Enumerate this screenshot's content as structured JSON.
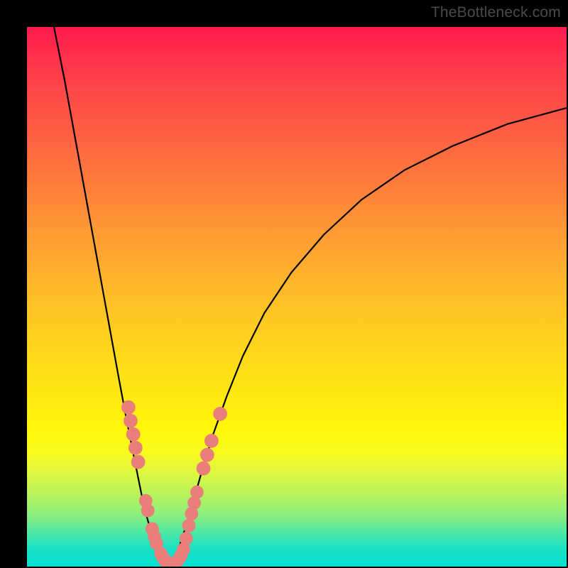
{
  "branding": {
    "watermark": "TheBottleneck.com"
  },
  "colors": {
    "gradient_top": "#ff1a4d",
    "gradient_mid": "#ffe812",
    "gradient_bottom": "#07dfd3",
    "curve": "#000000",
    "marker": "#e97e7b",
    "frame": "#000000"
  },
  "chart_data": {
    "type": "line",
    "title": "",
    "xlabel": "",
    "ylabel": "",
    "xlim": [
      0,
      100
    ],
    "ylim": [
      0,
      100
    ],
    "grid": false,
    "legend": false,
    "series": [
      {
        "name": "left-curve",
        "x": [
          5,
          7,
          9,
          11,
          13,
          15,
          17,
          18.5,
          19.5,
          20.5,
          21.3,
          22,
          22.7,
          23.4,
          24,
          24.6,
          25.2,
          25.8,
          26.3
        ],
        "y": [
          100,
          90,
          79,
          68,
          57,
          46,
          35,
          27,
          22,
          17,
          13,
          10,
          7.5,
          5.5,
          4,
          2.8,
          1.8,
          1,
          0.5
        ]
      },
      {
        "name": "right-curve",
        "x": [
          27,
          28,
          29.3,
          30.8,
          32.5,
          34.5,
          37,
          40,
          44,
          49,
          55,
          62,
          70,
          79,
          89,
          100
        ],
        "y": [
          0.5,
          3,
          7,
          12,
          18,
          24.5,
          31.5,
          39,
          47,
          54.5,
          61.5,
          68,
          73.5,
          78,
          82,
          85
        ]
      }
    ],
    "markers": [
      {
        "x": 18.8,
        "y": 29.5,
        "r": 1.1
      },
      {
        "x": 19.2,
        "y": 27.0,
        "r": 1.1
      },
      {
        "x": 19.7,
        "y": 24.5,
        "r": 1.1
      },
      {
        "x": 20.1,
        "y": 22.0,
        "r": 1.1
      },
      {
        "x": 20.6,
        "y": 19.4,
        "r": 1.1
      },
      {
        "x": 22.0,
        "y": 12.2,
        "r": 1.0
      },
      {
        "x": 22.4,
        "y": 10.4,
        "r": 1.0
      },
      {
        "x": 23.2,
        "y": 7.0,
        "r": 1.0
      },
      {
        "x": 23.6,
        "y": 5.6,
        "r": 1.0
      },
      {
        "x": 24.0,
        "y": 4.3,
        "r": 1.0
      },
      {
        "x": 24.8,
        "y": 2.4,
        "r": 1.0
      },
      {
        "x": 25.2,
        "y": 1.7,
        "r": 1.0
      },
      {
        "x": 25.6,
        "y": 1.1,
        "r": 1.0
      },
      {
        "x": 26.0,
        "y": 0.7,
        "r": 1.0
      },
      {
        "x": 26.4,
        "y": 0.5,
        "r": 1.0
      },
      {
        "x": 27.0,
        "y": 0.5,
        "r": 1.0
      },
      {
        "x": 27.5,
        "y": 0.7,
        "r": 1.0
      },
      {
        "x": 28.0,
        "y": 1.2,
        "r": 1.0
      },
      {
        "x": 28.5,
        "y": 2.0,
        "r": 1.0
      },
      {
        "x": 29.0,
        "y": 3.2,
        "r": 1.0
      },
      {
        "x": 29.5,
        "y": 5.2,
        "r": 1.0
      },
      {
        "x": 30.0,
        "y": 7.6,
        "r": 1.0
      },
      {
        "x": 30.5,
        "y": 9.8,
        "r": 1.0
      },
      {
        "x": 31.0,
        "y": 11.8,
        "r": 1.0
      },
      {
        "x": 31.5,
        "y": 13.8,
        "r": 1.0
      },
      {
        "x": 32.7,
        "y": 18.2,
        "r": 1.1
      },
      {
        "x": 33.4,
        "y": 20.7,
        "r": 1.1
      },
      {
        "x": 34.2,
        "y": 23.3,
        "r": 1.1
      },
      {
        "x": 35.8,
        "y": 28.3,
        "r": 1.1
      }
    ],
    "annotation": "Bottleneck curve with highlighted range near minimum"
  }
}
